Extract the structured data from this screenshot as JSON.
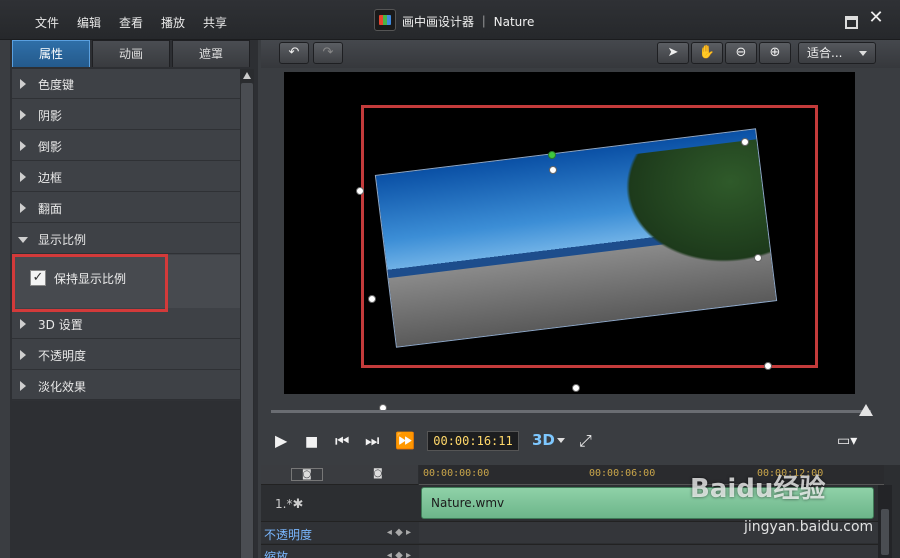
{
  "menu": [
    "文件",
    "编辑",
    "查看",
    "播放",
    "共享"
  ],
  "window": {
    "title": "画中画设计器 ｜ Nature"
  },
  "tabs": [
    {
      "label": "属性",
      "active": true
    },
    {
      "label": "动画",
      "active": false
    },
    {
      "label": "遮罩",
      "active": false
    }
  ],
  "properties": [
    {
      "label": "色度键",
      "expanded": false
    },
    {
      "label": "阴影",
      "expanded": false
    },
    {
      "label": "倒影",
      "expanded": false
    },
    {
      "label": "边框",
      "expanded": false
    },
    {
      "label": "翻面",
      "expanded": false
    },
    {
      "label": "显示比例",
      "expanded": true
    },
    {
      "label": "3D 设置",
      "expanded": false
    },
    {
      "label": "不透明度",
      "expanded": false
    },
    {
      "label": "淡化效果",
      "expanded": false
    }
  ],
  "aspect_option": {
    "label": "保持显示比例",
    "checked": true
  },
  "toolbar": {
    "fit": "适合..."
  },
  "player": {
    "timecode": "00:00:16:11",
    "three_d": "3D",
    "progress": 0.99
  },
  "timeline": {
    "ruler": [
      "00:00:00:00",
      "00:00:06:00",
      "00:00:12:00"
    ],
    "track_label": "1.*",
    "clip": "Nature.wmv",
    "keyframe_rows": [
      "不透明度",
      "缩放"
    ]
  },
  "watermark": {
    "brand": "Baidu经验",
    "url": "jingyan.baidu.com"
  },
  "colors": {
    "accent": "#2f6fa8",
    "highlight": "#d33a3a",
    "clip": "#8fd1a8",
    "timecode": "#ffd86a"
  }
}
